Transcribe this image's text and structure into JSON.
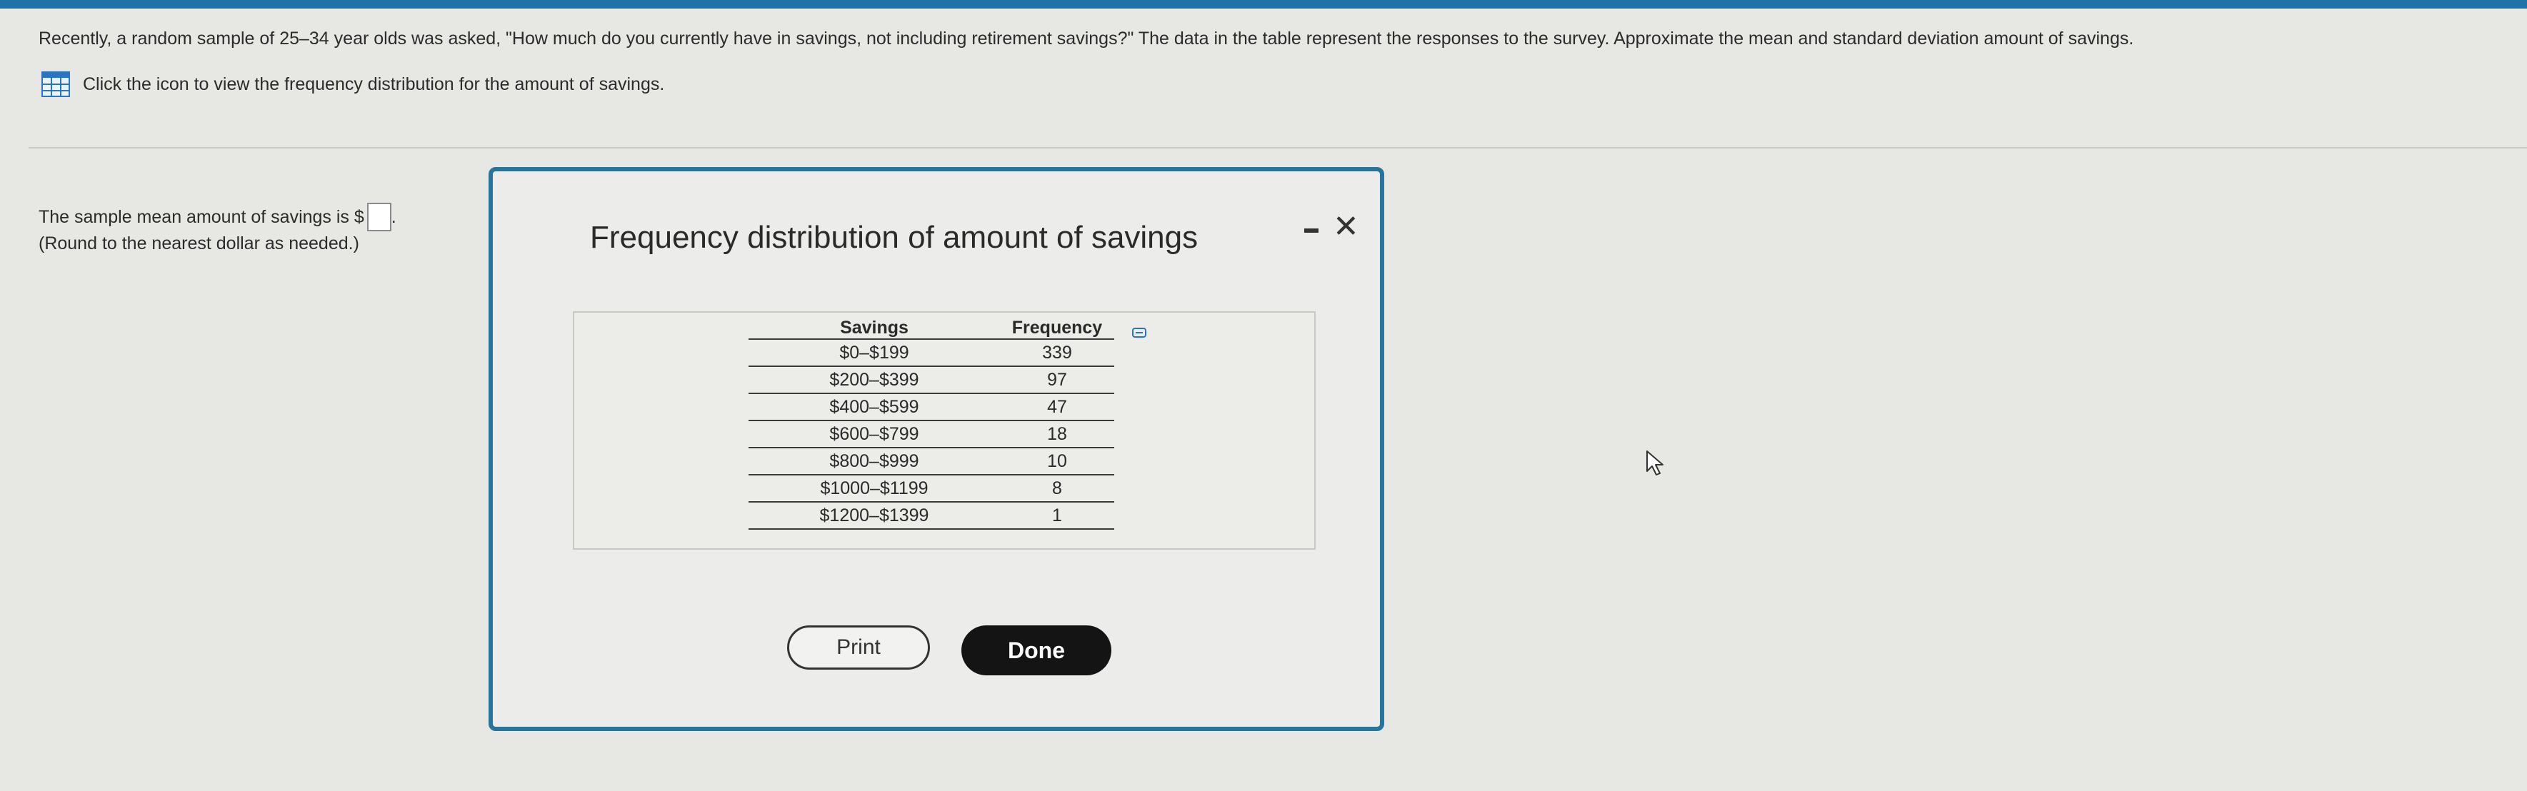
{
  "question": {
    "text": "Recently, a random sample of 25–34 year olds was asked, \"How much do you currently have in savings, not including retirement savings?\" The data in the table represent the responses to the survey. Approximate the mean and standard deviation amount of savings."
  },
  "view_link": {
    "icon": "table-icon",
    "text": "Click the icon to view the frequency distribution for the amount of savings."
  },
  "answer": {
    "prompt": "The sample mean amount of savings is $",
    "value": "",
    "note": "(Round to the nearest dollar as needed.)"
  },
  "dialog": {
    "title": "Frequency distribution of amount of savings",
    "table": {
      "headers": [
        "Savings",
        "Frequency"
      ],
      "rows": [
        [
          "$0–$199",
          "339"
        ],
        [
          "$200–$399",
          "97"
        ],
        [
          "$400–$599",
          "47"
        ],
        [
          "$600–$799",
          "18"
        ],
        [
          "$800–$999",
          "10"
        ],
        [
          "$1000–$1199",
          "8"
        ],
        [
          "$1200–$1399",
          "1"
        ]
      ]
    },
    "print_label": "Print",
    "done_label": "Done"
  },
  "colors": {
    "accent": "#27759a",
    "done_button": "#141414",
    "background": "#e7e7e3"
  }
}
